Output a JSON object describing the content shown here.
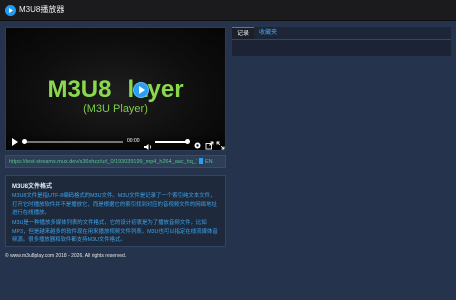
{
  "app": {
    "title": "M3U8播放器"
  },
  "player": {
    "brand_line1": "M3U8Player",
    "brand_line1_left": "M3U8",
    "brand_line1_right": "layer",
    "brand_line2": "(M3U Player)",
    "time": "00:00",
    "progress_percent": 0,
    "volume_percent": 100,
    "icons": [
      "play-icon",
      "volume-icon",
      "gear-icon",
      "share-icon",
      "fullscreen-icon"
    ]
  },
  "url_bar": {
    "url": "https://test-streams.mux.dev/x36xhzz/url_0/193039199_mp4_h264_aac_hq_7.m3u8",
    "language": "EN"
  },
  "info": {
    "title": "M3U8文件格式",
    "paragraph1": "M3U8文件是指UTF-8编码格式的M3U文件。M3U文件是记录了一个索引纯文本文件，打开它时播放软件并不是播放它，而是根据它的索引找到对应的音视频文件的网络地址进行在线播放。",
    "paragraph2": "M3U是一种播放多媒体列表的文件格式，它的设计初衷是为了播放音频文件，比如MP3，但是越来越多的软件现在用来播放视频文件列表，M3U也可以指定在线流媒体音频源。很多播放器和软件都支持M3U文件格式。"
  },
  "footer": {
    "copyright": "© www.m3u8play.com 2018 - 2026. All rights reserved."
  },
  "sidebar": {
    "tabs": [
      {
        "label": "记录",
        "active": true
      },
      {
        "label": "收藏夹",
        "active": false
      }
    ]
  },
  "colors": {
    "page_bg": "#25344c",
    "topbar_bg": "#1b1b1d",
    "accent": "#2a9df4",
    "brand_green": "#8ad94c",
    "url_green": "#59c08c",
    "link_blue": "#3fa3ec"
  }
}
